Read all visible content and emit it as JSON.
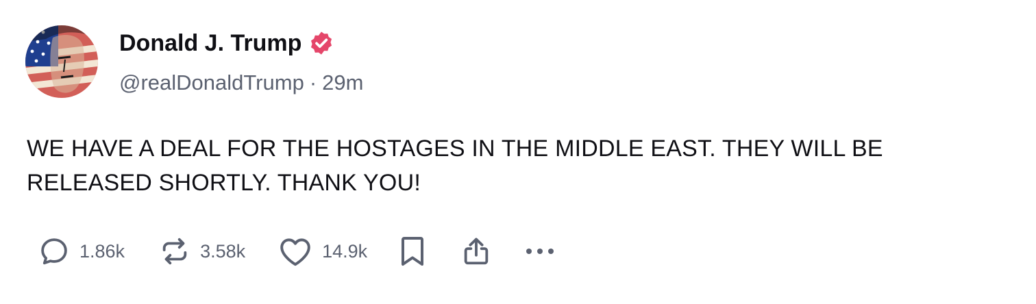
{
  "author": {
    "display_name": "Donald J. Trump",
    "handle": "@realDonaldTrump",
    "separator": "·",
    "timestamp": "29m",
    "verified_color": "#e5466a"
  },
  "post": {
    "text": "WE HAVE A DEAL FOR THE HOSTAGES IN THE MIDDLE EAST. THEY WILL BE RELEASED SHORTLY. THANK YOU!"
  },
  "actions": {
    "reply": {
      "icon": "reply-icon",
      "count": "1.86k"
    },
    "repost": {
      "icon": "repost-icon",
      "count": "3.58k"
    },
    "like": {
      "icon": "heart-icon",
      "count": "14.9k"
    },
    "bookmark": {
      "icon": "bookmark-icon"
    },
    "share": {
      "icon": "share-icon"
    },
    "more": {
      "icon": "more-icon"
    }
  },
  "colors": {
    "text": "#0f0f14",
    "muted": "#5b6170",
    "icon": "#5b6170"
  }
}
